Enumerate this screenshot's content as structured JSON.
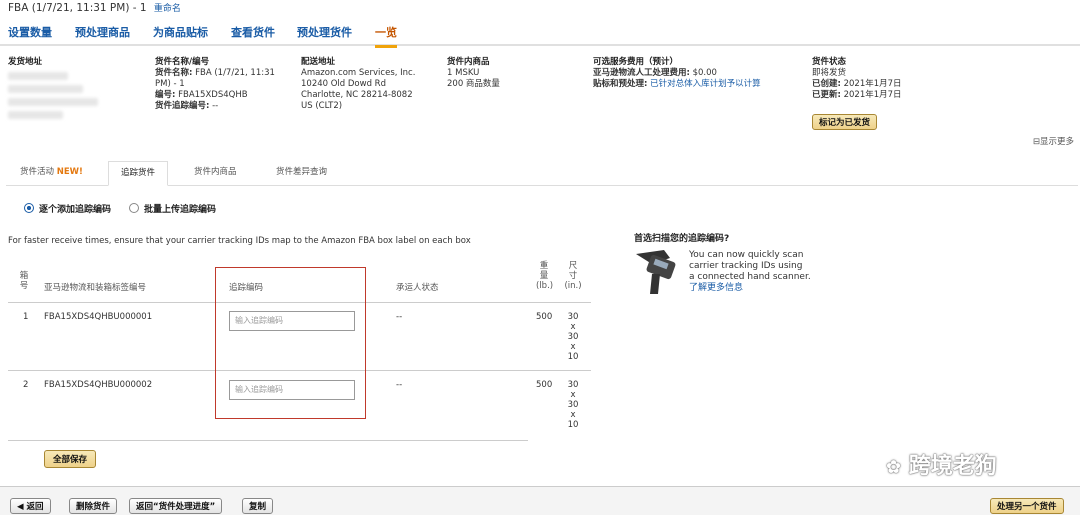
{
  "header": {
    "title": "FBA (1/7/21, 11:31 PM) - 1",
    "rename": "重命名"
  },
  "workflow_tabs": [
    "设置数量",
    "预处理商品",
    "为商品贴标",
    "查看货件",
    "预处理货件",
    "一览"
  ],
  "summary": {
    "ship_from": {
      "label": "发货地址"
    },
    "shipment": {
      "label": "货件名称/编号",
      "name_label": "货件名称:",
      "name_value": "FBA (1/7/21, 11:31",
      "name_value2": "PM) - 1",
      "id_label": "编号:",
      "id_value": "FBA15XDS4QHB",
      "tracking_label": "货件追踪编号:",
      "tracking_value": "--"
    },
    "ship_to": {
      "label": "配送地址",
      "lines": [
        "Amazon.com Services, Inc.",
        "10240 Old Dowd Rd",
        "Charlotte, NC 28214-8082",
        "US (CLT2)"
      ]
    },
    "contents": {
      "label": "货件内商品",
      "msku": "1 MSKU",
      "units": "200 商品数量"
    },
    "fees": {
      "label": "可选服务费用（预计）",
      "labor_label": "亚马逊物流人工处理费用:",
      "labor_value": "$0.00",
      "prep_label": "贴标和预处理:",
      "prep_value": "已针对总体入库计划予以计算"
    },
    "status": {
      "label": "货件状态",
      "value": "即将发货",
      "created_label": "已创建:",
      "created_value": "2021年1月7日",
      "updated_label": "已更新:",
      "updated_value": "2021年1月7日",
      "mark_button": "标记为已发货"
    }
  },
  "show_more": "显示更多",
  "sub_tabs": {
    "activity": "货件活动",
    "new_badge": "NEW!",
    "tracking": "追踪货件",
    "contents": "货件内商品",
    "discrepancy": "货件差异查询"
  },
  "radios": {
    "individual": "逐个添加追踪编码",
    "bulk": "批量上传追踪编码"
  },
  "note": "For faster receive times, ensure that your carrier tracking IDs map to the Amazon FBA box label on each box",
  "table": {
    "headers": {
      "no_1": "箱",
      "no_2": "号",
      "label_id": "亚马逊物流和装箱标签编号",
      "tracking": "追踪编码",
      "carrier_status": "承运人状态",
      "weight_1": "重",
      "weight_2": "量",
      "weight_3": "(lb.)",
      "dims_1": "尺",
      "dims_2": "寸",
      "dims_3": "(in.)"
    },
    "rows": [
      {
        "no": "1",
        "label_id": "FBA15XDS4QHBU000001",
        "tracking_placeholder": "输入追踪编码",
        "carrier_status": "--",
        "weight": "500",
        "d1": "30",
        "x1": "x",
        "d2": "30",
        "x2": "x",
        "d3": "10"
      },
      {
        "no": "2",
        "label_id": "FBA15XDS4QHBU000002",
        "tracking_placeholder": "输入追踪编码",
        "carrier_status": "--",
        "weight": "500",
        "d1": "30",
        "x1": "x",
        "d2": "30",
        "x2": "x",
        "d3": "10"
      }
    ]
  },
  "save_all": "全部保存",
  "scanner": {
    "heading": "首选扫描您的追踪编码?",
    "line1": "You can now quickly scan",
    "line2": "carrier tracking IDs using",
    "line3": "a connected hand scanner.",
    "learn_more": "了解更多信息"
  },
  "footer": {
    "back": "返回",
    "delete": "删除货件",
    "back_progress": "返回“货件处理进度”",
    "copy": "复制",
    "process_another": "处理另一个货件"
  },
  "watermark": "跨境老狗",
  "colors": {
    "link": "#1a5ca6",
    "active_tab": "#c45500",
    "accent": "#f0a30a",
    "highlight_box": "#c0392b"
  }
}
